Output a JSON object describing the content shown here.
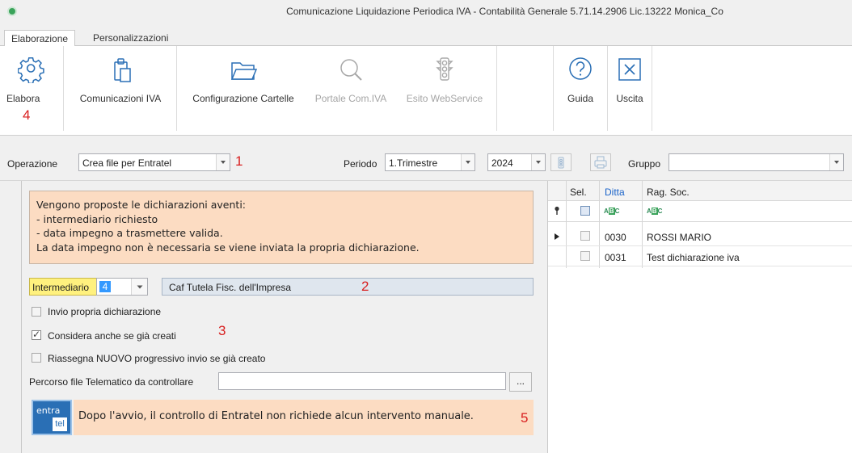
{
  "window": {
    "title": "Comunicazione Liquidazione Periodica IVA - Contabilità Generale 5.71.14.2906 Lic.13222 Monica_Co"
  },
  "tabs": [
    {
      "label": "Elaborazione",
      "active": true
    },
    {
      "label": "Personalizzazioni",
      "active": false
    }
  ],
  "ribbon": {
    "buttons": [
      {
        "label": "Elabora",
        "icon": "gear-icon",
        "enabled": true
      },
      {
        "label": "Comunicazioni IVA",
        "icon": "clipboard-icon",
        "enabled": true
      },
      {
        "label": "Configurazione Cartelle",
        "icon": "folder-icon",
        "enabled": true
      },
      {
        "label": "Portale Com.IVA",
        "icon": "search-icon",
        "enabled": false
      },
      {
        "label": "Esito WebService",
        "icon": "traffic-light-icon",
        "enabled": false
      },
      {
        "label": "Guida",
        "icon": "help-icon",
        "enabled": true
      },
      {
        "label": "Uscita",
        "icon": "close-icon",
        "enabled": true
      }
    ]
  },
  "annotations": {
    "n1": "1",
    "n2": "2",
    "n3": "3",
    "n4": "4",
    "n5": "5"
  },
  "filters": {
    "operazione_label": "Operazione",
    "operazione_value": "Crea file per Entratel",
    "periodo_label": "Periodo",
    "periodo_value": "1.Trimestre",
    "anno_value": "2024",
    "gruppo_label": "Gruppo",
    "gruppo_value": ""
  },
  "info": {
    "lines": [
      "Vengono proposte le dichiarazioni aventi:",
      "- intermediario richiesto",
      "- data impegno a trasmettere valida.",
      "La data impegno non è necessaria se viene inviata la propria dichiarazione."
    ]
  },
  "intermediario": {
    "label": "Intermediario",
    "code": "4",
    "name": "Caf Tutela Fisc. dell'Impresa"
  },
  "options": [
    {
      "label": "Invio propria dichiarazione",
      "checked": false
    },
    {
      "label": "Considera anche se già creati",
      "checked": true
    },
    {
      "label": "Riassegna NUOVO progressivo invio se già creato",
      "checked": false
    }
  ],
  "path": {
    "label": "Percorso file Telematico da controllare",
    "value": "",
    "browse_label": "..."
  },
  "entratel": {
    "logo_top": "entra",
    "logo_bottom": "tel",
    "note": "Dopo l'avvio, il controllo di Entratel non richiede alcun intervento manuale."
  },
  "grid": {
    "headers": {
      "sel": "Sel.",
      "ditta": "Ditta",
      "ragsoc": "Rag. Soc."
    },
    "filter_abc": {
      "a": "A",
      "b": "B",
      "c": "C"
    },
    "rows": [
      {
        "ditta": "0030",
        "ragsoc": "ROSSI MARIO",
        "selected": false,
        "current": true
      },
      {
        "ditta": "0031",
        "ragsoc": "Test dichiarazione iva",
        "selected": false,
        "current": false
      }
    ]
  },
  "colors": {
    "info_bg": "#fcdcc2",
    "intermediario_bg": "#fff17e",
    "annotation": "#d81e1e",
    "link_blue": "#1a63c9"
  }
}
